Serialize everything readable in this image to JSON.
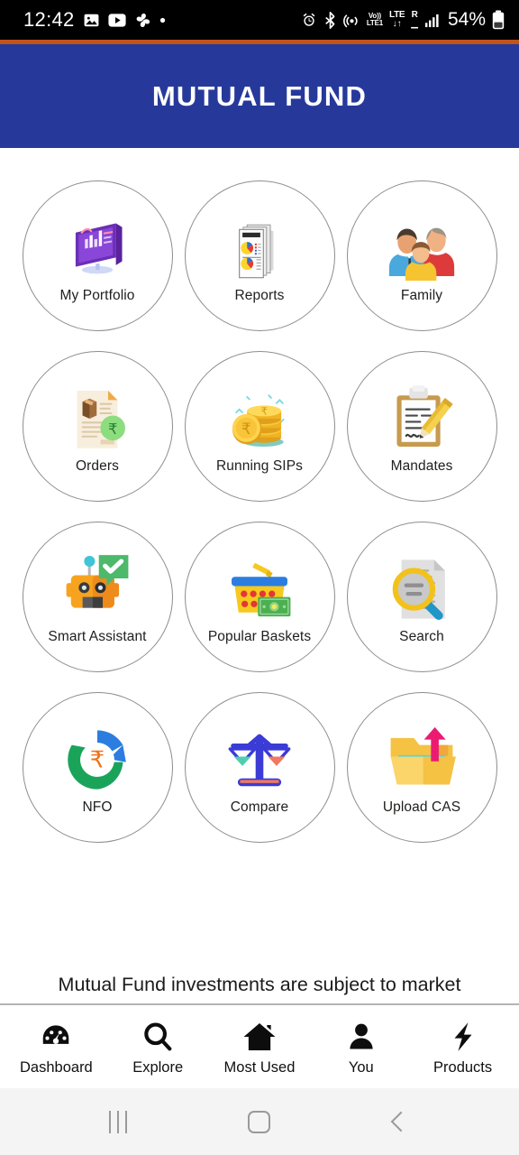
{
  "status_bar": {
    "clock": "12:42",
    "battery_percent": "54%",
    "left_icons": [
      "photos-icon",
      "youtube-icon",
      "apps-cluster-icon",
      "dot-icon"
    ],
    "right_icons": [
      "alarm-icon",
      "bluetooth-icon",
      "hotspot-icon",
      "volte-icon",
      "lte-roaming-icon",
      "signal-bars-icon",
      "battery-icon"
    ],
    "volte_top": "Vo))",
    "volte_bottom": "LTE1",
    "lte_label": "LTE",
    "roaming_label": "R"
  },
  "header": {
    "title": "MUTUAL FUND",
    "bg_color": "#26399b",
    "accent_color": "#c0541b"
  },
  "grid": {
    "items": [
      {
        "label": "My Portfolio",
        "icon": "monitor-dashboard-icon"
      },
      {
        "label": "Reports",
        "icon": "documents-piechart-icon"
      },
      {
        "label": "Family",
        "icon": "family-people-icon"
      },
      {
        "label": "Orders",
        "icon": "document-parcel-rupee-icon"
      },
      {
        "label": "Running SIPs",
        "icon": "gold-coins-rupee-icon"
      },
      {
        "label": "Mandates",
        "icon": "clipboard-pencil-icon"
      },
      {
        "label": "Smart Assistant",
        "icon": "robot-chat-check-icon"
      },
      {
        "label": "Popular Baskets",
        "icon": "basket-money-icon"
      },
      {
        "label": "Search",
        "icon": "document-magnifier-icon"
      },
      {
        "label": "NFO",
        "icon": "circular-arrows-rupee-icon"
      },
      {
        "label": "Compare",
        "icon": "balance-scale-icon"
      },
      {
        "label": "Upload CAS",
        "icon": "folder-upload-arrow-icon"
      }
    ]
  },
  "disclaimer": {
    "text": "Mutual Fund investments are subject to market"
  },
  "tab_bar": {
    "tabs": [
      {
        "label": "Dashboard",
        "icon": "speedometer-icon"
      },
      {
        "label": "Explore",
        "icon": "magnifier-icon"
      },
      {
        "label": "Most Used",
        "icon": "home-icon"
      },
      {
        "label": "You",
        "icon": "person-icon"
      },
      {
        "label": "Products",
        "icon": "lightning-bolt-icon"
      }
    ]
  },
  "system_nav": {
    "recents": "recents-icon",
    "home": "home-square-icon",
    "back": "back-chevron-icon"
  }
}
